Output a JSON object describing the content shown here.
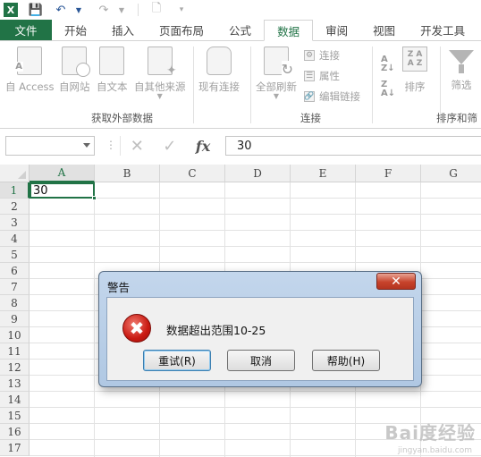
{
  "qat": {
    "app_icon": "X",
    "save_icon": "save-icon",
    "undo_icon": "undo-icon",
    "redo_icon": "redo-icon",
    "new_icon": "new-document-icon"
  },
  "tabs": [
    "文件",
    "开始",
    "插入",
    "页面布局",
    "公式",
    "数据",
    "审阅",
    "视图",
    "开发工具"
  ],
  "active_tab": "数据",
  "ribbon": {
    "get_external": {
      "buttons": [
        "自 Access",
        "自网站",
        "自文本",
        "自其他来源",
        "现有连接"
      ],
      "label": "获取外部数据"
    },
    "connections": {
      "refresh_label": "全部刷新",
      "items": [
        "连接",
        "属性",
        "编辑链接"
      ],
      "label": "连接"
    },
    "sort_filter": {
      "sort_label": "排序",
      "filter_label": "筛选",
      "label": "排序和筛"
    }
  },
  "formula_bar": {
    "name_box": "",
    "fx": "fx",
    "value": "30"
  },
  "sheet": {
    "columns": [
      "A",
      "B",
      "C",
      "D",
      "E",
      "F",
      "G"
    ],
    "rows": [
      "1",
      "2",
      "3",
      "4",
      "5",
      "6",
      "7",
      "8",
      "9",
      "10",
      "11",
      "12",
      "13",
      "14",
      "15",
      "16",
      "17"
    ],
    "selected_cell_value": "30"
  },
  "dialog": {
    "title": "警告",
    "close": "✕",
    "message": "数据超出范围10-25",
    "buttons": {
      "retry": "重试(R)",
      "cancel": "取消",
      "help": "帮助(H)"
    }
  },
  "watermark": {
    "main": "Bai度经验",
    "sub": "jingyan.baidu.com"
  },
  "colors": {
    "excel_green": "#217346",
    "dialog_frame": "#b0c8e3",
    "error_red": "#c91a12"
  }
}
